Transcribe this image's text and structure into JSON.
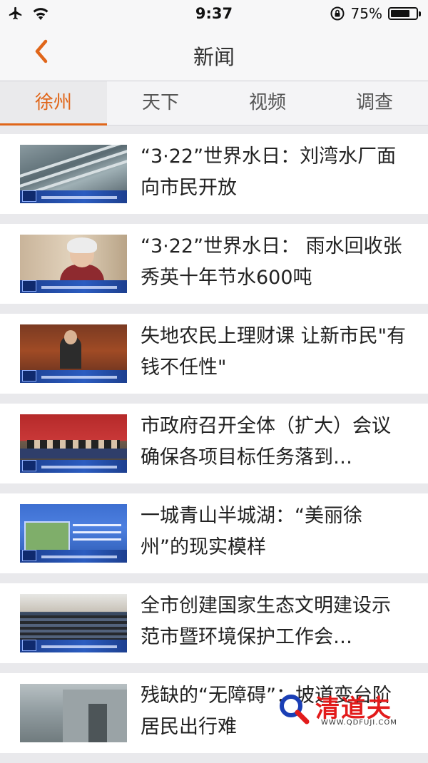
{
  "status_bar": {
    "time": "9:37",
    "battery_text": "75%",
    "battery_level": 0.75,
    "icons": [
      "airplane-icon",
      "wifi-icon",
      "rotation-lock-icon",
      "battery-icon"
    ]
  },
  "nav": {
    "title": "新闻",
    "back_icon": "chevron-left-icon",
    "accent_color": "#e0661a"
  },
  "tabs": [
    {
      "label": "徐州",
      "active": true
    },
    {
      "label": "天下",
      "active": false
    },
    {
      "label": "视频",
      "active": false
    },
    {
      "label": "调查",
      "active": false
    }
  ],
  "news": [
    {
      "title": "“3·22”世界水日：刘湾水厂面向市民开放"
    },
    {
      "title": "“3·22”世界水日： 雨水回收张秀英十年节水600吨"
    },
    {
      "title": "失地农民上理财课 让新市民\"有钱不任性\""
    },
    {
      "title": "市政府召开全体（扩大）会议 确保各项目标任务落到…"
    },
    {
      "title": "一城青山半城湖：“美丽徐州”的现实模样"
    },
    {
      "title": "全市创建国家生态文明建设示范市暨环境保护工作会…"
    },
    {
      "title": "残缺的“无障碍”：坡道变台阶 居民出行难"
    }
  ],
  "watermark": {
    "text": "清道夫",
    "url": "WWW.QDFUJI.COM"
  }
}
